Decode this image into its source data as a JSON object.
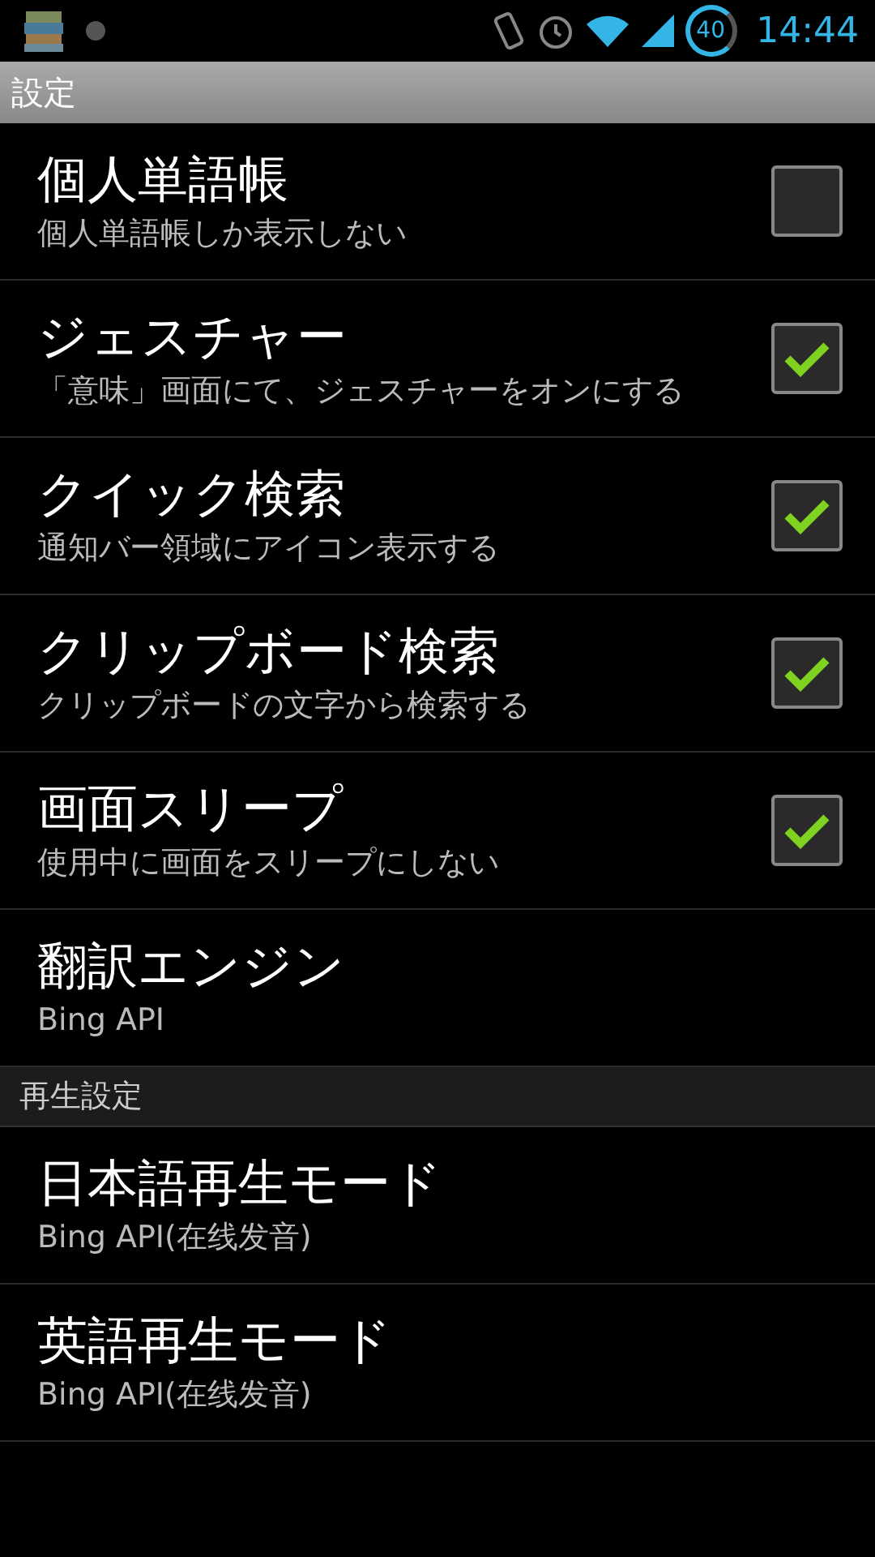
{
  "status_bar": {
    "battery": "40",
    "time": "14:44"
  },
  "header": {
    "title": "設定"
  },
  "sections": [
    {
      "items": [
        {
          "kind": "checkbox",
          "title": "個人単語帳",
          "summary": "個人単語帳しか表示しない",
          "checked": false
        },
        {
          "kind": "checkbox",
          "title": "ジェスチャー",
          "summary": "「意味」画面にて、ジェスチャーをオンにする",
          "checked": true
        },
        {
          "kind": "checkbox",
          "title": "クイック検索",
          "summary": "通知バー領域にアイコン表示する",
          "checked": true
        },
        {
          "kind": "checkbox",
          "title": "クリップボード検索",
          "summary": "クリップボードの文字から検索する",
          "checked": true
        },
        {
          "kind": "checkbox",
          "title": "画面スリープ",
          "summary": "使用中に画面をスリープにしない",
          "checked": true
        },
        {
          "kind": "plain",
          "title": "翻訳エンジン",
          "summary": "Bing API"
        }
      ]
    },
    {
      "title": "再生設定",
      "items": [
        {
          "kind": "plain",
          "title": "日本語再生モード",
          "summary": "Bing API(在线发音)"
        },
        {
          "kind": "plain",
          "title": "英語再生モード",
          "summary": "Bing API(在线发音)"
        }
      ]
    }
  ]
}
